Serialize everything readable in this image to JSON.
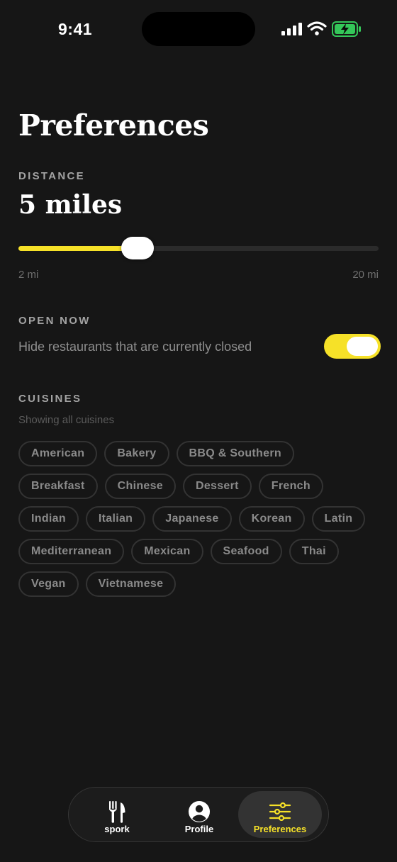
{
  "status": {
    "time": "9:41",
    "battery_color": "#34c759"
  },
  "page": {
    "title": "Preferences"
  },
  "distance": {
    "label": "DISTANCE",
    "value_text": "5 miles",
    "value": 5,
    "min": 2,
    "max": 20,
    "min_label": "2 mi",
    "max_label": "20 mi"
  },
  "open_now": {
    "label": "OPEN NOW",
    "description": "Hide restaurants that are currently closed",
    "enabled": true
  },
  "cuisines": {
    "label": "CUISINES",
    "subtitle": "Showing all cuisines",
    "items": [
      "American",
      "Bakery",
      "BBQ & Southern",
      "Breakfast",
      "Chinese",
      "Dessert",
      "French",
      "Indian",
      "Italian",
      "Japanese",
      "Korean",
      "Latin",
      "Mediterranean",
      "Mexican",
      "Seafood",
      "Thai",
      "Vegan",
      "Vietnamese"
    ]
  },
  "tabbar": {
    "tabs": [
      {
        "label": "spork",
        "icon": "fork-knife-icon",
        "active": false
      },
      {
        "label": "Profile",
        "icon": "person-circle-icon",
        "active": false
      },
      {
        "label": "Preferences",
        "icon": "sliders-icon",
        "active": true
      }
    ]
  },
  "colors": {
    "accent": "#f6e128",
    "background": "#161616"
  }
}
